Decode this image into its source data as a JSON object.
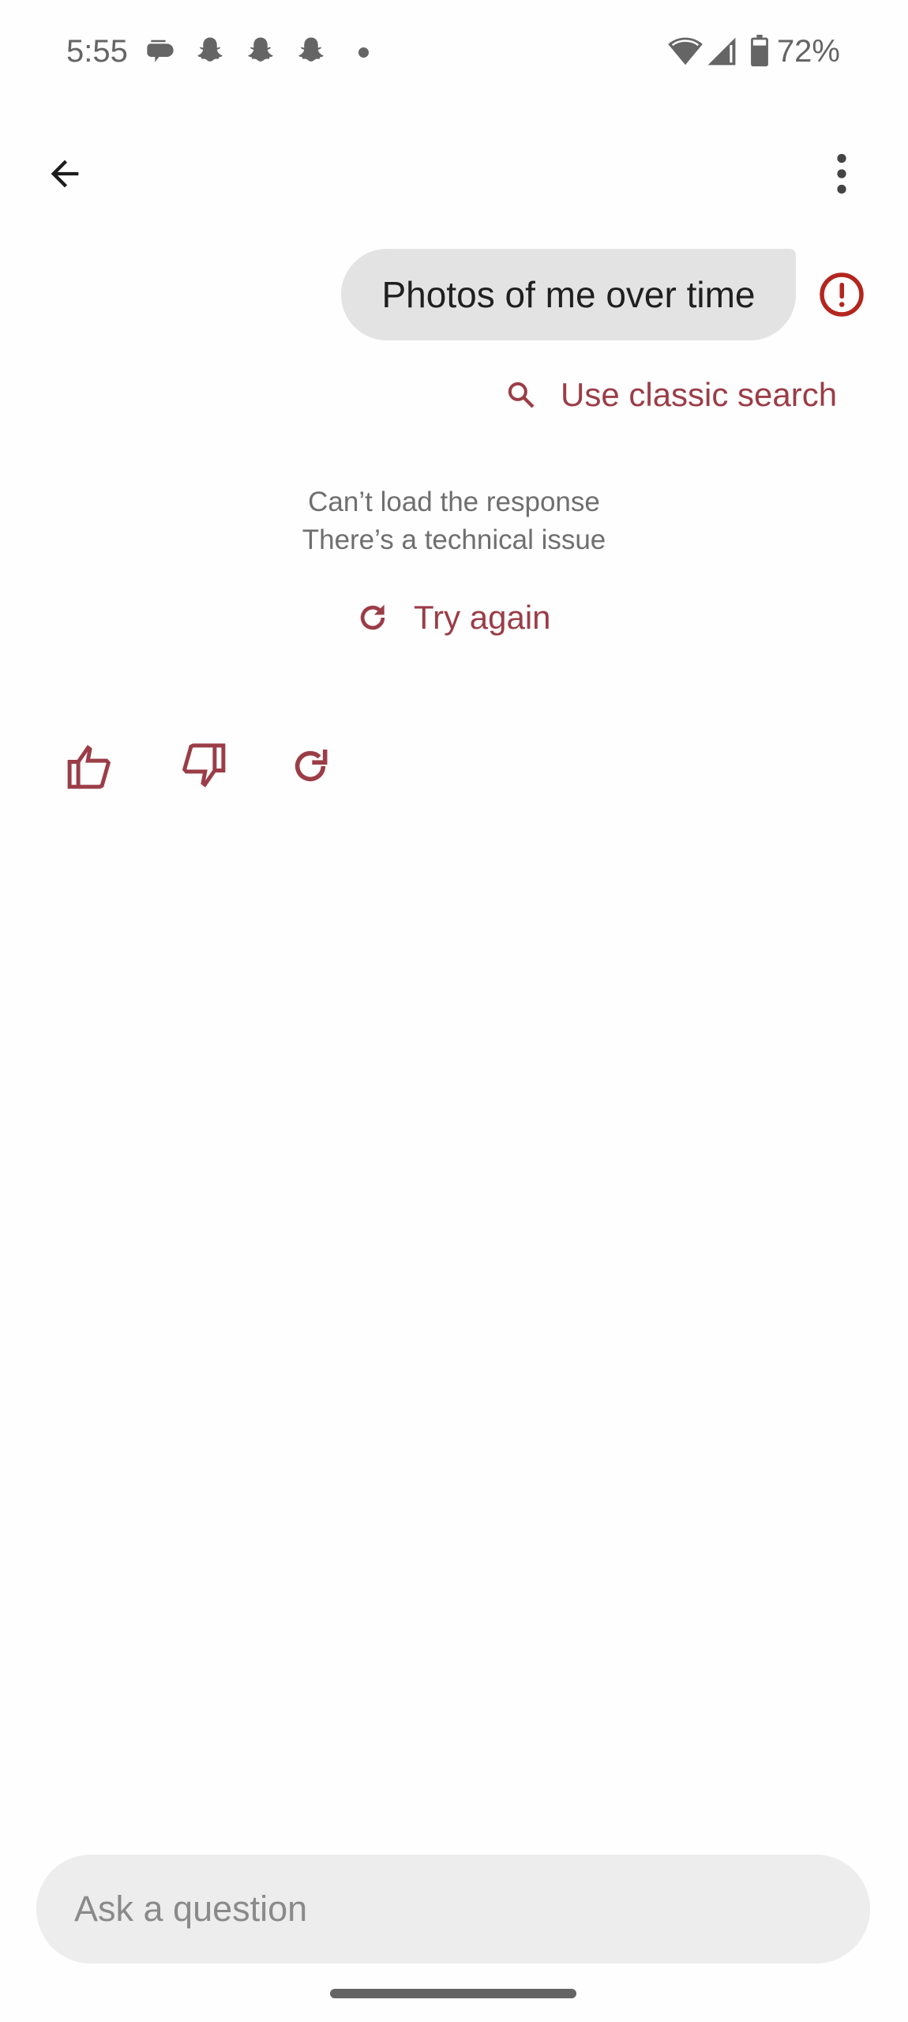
{
  "status_bar": {
    "time": "5:55",
    "notification_icons": [
      "messages-icon",
      "snapchat-icon",
      "snapchat-icon",
      "snapchat-icon",
      "more-notifications-dot"
    ],
    "system_icons": [
      "wifi-icon",
      "cellular-signal-icon",
      "battery-icon"
    ],
    "battery_percent": "72%"
  },
  "top_bar": {
    "back_icon": "arrow-back-icon",
    "more_icon": "more-vert-icon"
  },
  "conversation": {
    "user_query": "Photos of me over time",
    "query_status_icon": "error-icon",
    "classic_search_label": "Use classic search",
    "error_title": "Can’t load the response",
    "error_subtitle": "There’s a technical issue",
    "retry_label": "Try again"
  },
  "feedback": {
    "items": [
      "thumb-up-icon",
      "thumb-down-icon",
      "refresh-icon"
    ]
  },
  "composer": {
    "placeholder": "Ask a question",
    "value": ""
  },
  "colors": {
    "accent": "#9b3d47",
    "error": "#b3261e",
    "bubble": "#e3e3e3",
    "input_bg": "#ededed",
    "muted_text": "#6f6f6f"
  }
}
